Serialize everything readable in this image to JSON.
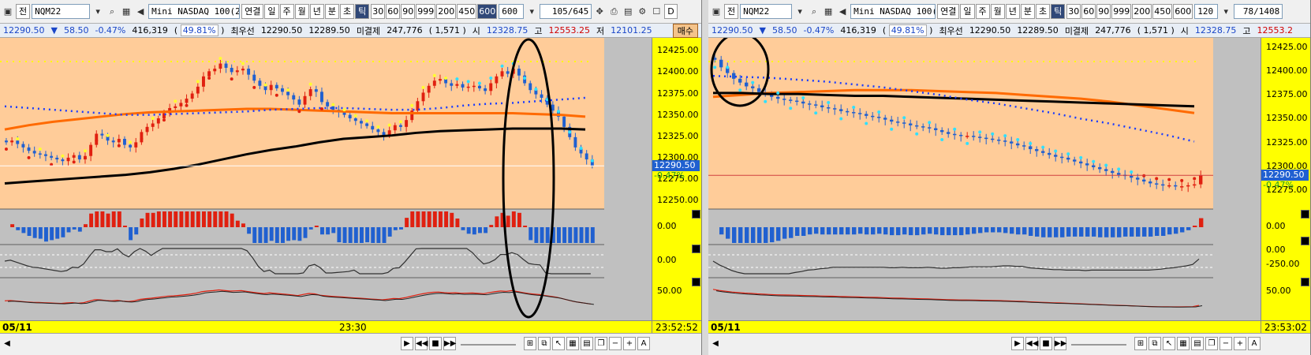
{
  "left": {
    "symbol": "NQM22",
    "tab_icon_label": "전",
    "instrument": "Mini NASDAQ 100(22.0",
    "period_tabs": [
      "연결",
      "일",
      "주",
      "월",
      "년",
      "분",
      "초",
      "틱"
    ],
    "active_period": "틱",
    "intervals": [
      "30",
      "60",
      "90",
      "999",
      "200",
      "450",
      "600"
    ],
    "active_interval": "600",
    "interval_select": "600",
    "counter": "105/645",
    "quote": {
      "price": "12290.50",
      "change": "58.50",
      "change_pct": "-0.47%",
      "volume": "416,319",
      "volume_pct": "49.81%",
      "best_label": "최우선",
      "best_ask": "12290.50",
      "best_bid": "12289.50",
      "oi_label": "미결제",
      "open_interest": "247,776",
      "oi_change": "1,571",
      "open_label": "시",
      "open": "12328.75",
      "high_label": "고",
      "high": "12553.25",
      "low_label": "저",
      "low": "12101.25",
      "buy_label": "매수"
    },
    "price_axis": [
      "12425.00",
      "12400.00",
      "12375.00",
      "12350.00",
      "12325.00",
      "12300.00",
      "12290.50",
      "12275.00",
      "12250.00"
    ],
    "price_tag": "12290.50",
    "price_tag_pct": "-0.47%",
    "osc1_label": "0.00",
    "osc2_label": "0.00",
    "osc3_label": "50.00",
    "date_label": "05/11",
    "time_tick": "23:30",
    "clock": "23:52:52"
  },
  "right": {
    "symbol": "NQM22",
    "tab_icon_label": "전",
    "instrument": "Mini NASDAQ 100(22.0",
    "period_tabs": [
      "연결",
      "일",
      "주",
      "월",
      "년",
      "분",
      "초",
      "틱"
    ],
    "active_period": "틱",
    "intervals": [
      "30",
      "60",
      "90",
      "999",
      "200",
      "450",
      "600"
    ],
    "active_interval": "",
    "interval_select": "120",
    "counter": "78/1408",
    "quote": {
      "price": "12290.50",
      "change": "58.50",
      "change_pct": "-0.47%",
      "volume": "416,319",
      "volume_pct": "49.81%",
      "best_label": "최우선",
      "best_ask": "12290.50",
      "best_bid": "12289.50",
      "oi_label": "미결제",
      "open_interest": "247,776",
      "oi_change": "1,571",
      "open_label": "시",
      "open": "12328.75",
      "high_label": "고",
      "high": "12553.2"
    },
    "price_axis": [
      "12425.00",
      "12400.00",
      "12375.00",
      "12350.00",
      "12325.00",
      "12300.00",
      "12290.50",
      "12275.00"
    ],
    "price_tag": "12290.50",
    "price_tag_pct": "-0.47%",
    "osc1_label": "0.00",
    "osc2_label": "0.00",
    "osc2b_label": "-250.00",
    "osc3_label": "50.00",
    "date_label": "05/11",
    "clock": "23:53:02"
  },
  "chart_data": [
    {
      "type": "candlestick",
      "panel": "left",
      "y_range": [
        12240,
        12440
      ],
      "close": [
        12318,
        12320,
        12316,
        12312,
        12308,
        12305,
        12304,
        12302,
        12300,
        12298,
        12296,
        12300,
        12303,
        12298,
        12302,
        12315,
        12328,
        12326,
        12320,
        12318,
        12322,
        12315,
        12312,
        12318,
        12330,
        12336,
        12340,
        12346,
        12352,
        12358,
        12360,
        12364,
        12369,
        12375,
        12383,
        12395,
        12401,
        12404,
        12410,
        12405,
        12400,
        12402,
        12404,
        12397,
        12390,
        12384,
        12379,
        12385,
        12381,
        12377,
        12373,
        12368,
        12362,
        12372,
        12380,
        12377,
        12365,
        12360,
        12356,
        12353,
        12350,
        12346,
        12343,
        12340,
        12337,
        12333,
        12330,
        12326,
        12332,
        12338,
        12336,
        12344,
        12355,
        12366,
        12376,
        12384,
        12390,
        12392,
        12387,
        12384,
        12386,
        12382,
        12383,
        12384,
        12381,
        12378,
        12387,
        12395,
        12401,
        12398,
        12404,
        12396,
        12387,
        12379,
        12374,
        12370,
        12362,
        12355,
        12348,
        12336,
        12324,
        12312,
        12305,
        12298,
        12290.5
      ],
      "ma_black": [
        12270,
        12272,
        12274,
        12276,
        12278,
        12280,
        12283,
        12287,
        12292,
        12298,
        12304,
        12309,
        12313,
        12318,
        12322,
        12324,
        12326,
        12329,
        12331,
        12332,
        12333,
        12334,
        12334,
        12334,
        12333
      ],
      "ma_orange": [
        12333,
        12338,
        12342,
        12345,
        12348,
        12351,
        12353,
        12354,
        12355,
        12356,
        12357,
        12357,
        12356,
        12355,
        12354,
        12353,
        12352,
        12352,
        12352,
        12352,
        12352,
        12352,
        12351,
        12350,
        12348
      ],
      "ma_blue_dots": [
        12360,
        12358,
        12356,
        12354,
        12352,
        12350,
        12350,
        12351,
        12352,
        12353,
        12354,
        12356,
        12357,
        12358,
        12358,
        12357,
        12356,
        12356,
        12358,
        12361,
        12363,
        12364,
        12366,
        12368,
        12370
      ]
    },
    {
      "type": "candlestick",
      "panel": "right",
      "y_range": [
        12255,
        12435
      ],
      "close": [
        12412,
        12404,
        12398,
        12392,
        12388,
        12384,
        12382,
        12378,
        12376,
        12373,
        12371,
        12370,
        12369,
        12368,
        12366,
        12365,
        12364,
        12362,
        12361,
        12360,
        12358,
        12357,
        12356,
        12355,
        12353,
        12352,
        12351,
        12349,
        12347,
        12346,
        12345,
        12343,
        12342,
        12341,
        12340,
        12338,
        12336,
        12334,
        12333,
        12332,
        12332,
        12331,
        12330,
        12329,
        12328,
        12327,
        12326,
        12324,
        12322,
        12321,
        12318,
        12316,
        12314,
        12312,
        12310,
        12309,
        12307,
        12305,
        12303,
        12301,
        12299,
        12297,
        12295,
        12293,
        12291,
        12290,
        12288,
        12286,
        12284,
        12282,
        12281,
        12280,
        12280,
        12279,
        12279,
        12280,
        12281,
        12290.5
      ],
      "ma_black": [
        12377,
        12377,
        12376,
        12376,
        12375,
        12374,
        12374,
        12373,
        12372,
        12371,
        12370,
        12369,
        12368,
        12367,
        12366,
        12365,
        12364,
        12363
      ],
      "ma_orange": [
        12373,
        12375,
        12377,
        12378,
        12379,
        12380,
        12380,
        12380,
        12379,
        12378,
        12377,
        12375,
        12373,
        12371,
        12368,
        12364,
        12360,
        12356
      ],
      "ma_blue_dots": [
        12395,
        12394,
        12393,
        12391,
        12389,
        12386,
        12383,
        12379,
        12375,
        12370,
        12366,
        12361,
        12356,
        12350,
        12345,
        12339,
        12333,
        12326
      ]
    }
  ],
  "colors": {
    "up_candle": "#e02010",
    "down_candle": "#2060d0",
    "price_pane": "#ffcc99",
    "axis_bg": "#ffff00",
    "ma_orange": "#ff6a00",
    "cloud_purple": "#8b1a8b",
    "highlight_ellipse": "#000000"
  }
}
